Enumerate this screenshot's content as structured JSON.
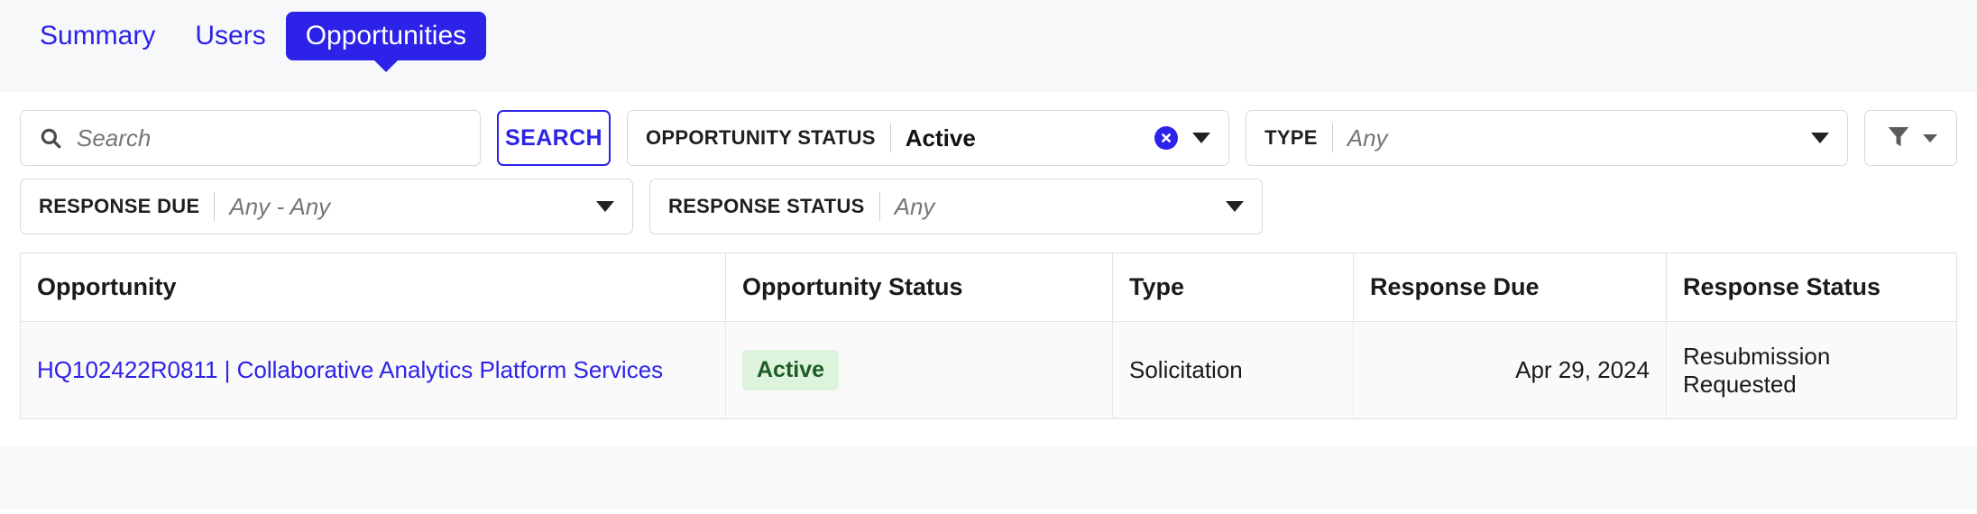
{
  "tabs": [
    {
      "label": "Summary",
      "active": false
    },
    {
      "label": "Users",
      "active": false
    },
    {
      "label": "Opportunities",
      "active": true
    }
  ],
  "search": {
    "placeholder": "Search",
    "value": "",
    "button_label": "SEARCH",
    "icon": "search-icon"
  },
  "filters": {
    "opportunity_status": {
      "label": "OPPORTUNITY STATUS",
      "value": "Active",
      "is_placeholder": false,
      "clearable": true,
      "clear_icon": "circle-x-icon"
    },
    "type": {
      "label": "TYPE",
      "value": "Any",
      "is_placeholder": true,
      "clearable": false
    },
    "response_due": {
      "label": "RESPONSE DUE",
      "value": "Any - Any",
      "is_placeholder": true,
      "clearable": false
    },
    "response_status": {
      "label": "RESPONSE STATUS",
      "value": "Any",
      "is_placeholder": true,
      "clearable": false
    },
    "filter_button": {
      "icon": "funnel-icon",
      "caret": "chevron-down-icon"
    }
  },
  "table": {
    "columns": [
      {
        "label": "Opportunity",
        "align": "left"
      },
      {
        "label": "Opportunity Status",
        "align": "left"
      },
      {
        "label": "Type",
        "align": "left"
      },
      {
        "label": "Response Due",
        "align": "right"
      },
      {
        "label": "Response Status",
        "align": "left"
      }
    ],
    "rows": [
      {
        "opportunity": "HQ102422R0811 | Collaborative Analytics Platform Services",
        "opportunity_status": "Active",
        "type": "Solicitation",
        "response_due": "Apr 29, 2024",
        "response_status": "Resubmission Requested"
      }
    ]
  },
  "colors": {
    "accent_blue": "#2d22e8",
    "badge_bg": "#ddf3dc",
    "badge_text": "#1d5c22",
    "nav_bg": "#f7f8fa"
  }
}
